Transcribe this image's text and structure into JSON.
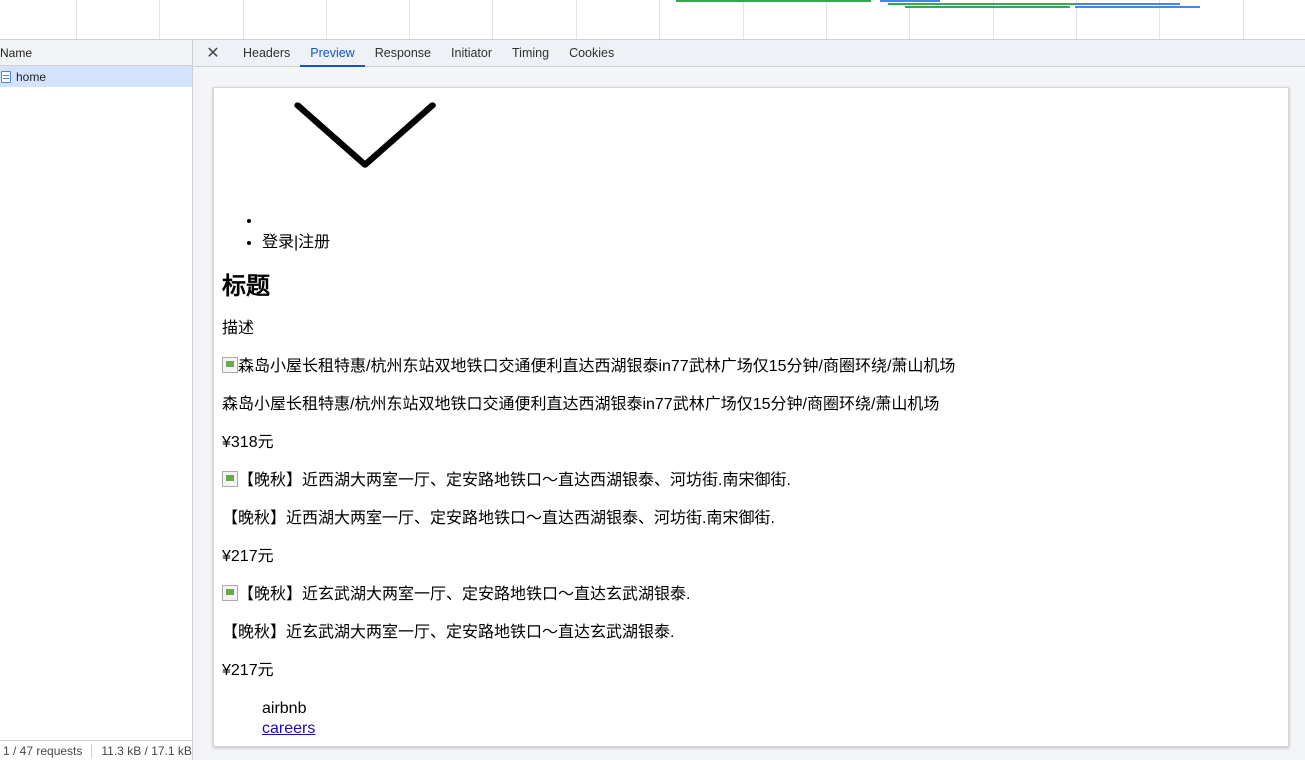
{
  "request_list": {
    "column_header": "Name",
    "rows": [
      {
        "name": "home",
        "icon": "document-icon"
      }
    ],
    "status": {
      "requests": "1 / 47 requests",
      "transferred": "11.3 kB / 17.1 kB"
    }
  },
  "detail_tabs": {
    "close_icon": "close-icon",
    "tabs": [
      "Headers",
      "Preview",
      "Response",
      "Initiator",
      "Timing",
      "Cookies"
    ],
    "active": "Preview"
  },
  "preview": {
    "nav_items": [
      "",
      "登录|注册"
    ],
    "title": "标题",
    "description": "描述",
    "listings": [
      {
        "image_alt": "森岛小屋长租特惠/杭州东站双地铁口交通便利直达西湖银泰in77武林广场仅15分钟/商圈环绕/萧山机场",
        "name": "森岛小屋长租特惠/杭州东站双地铁口交通便利直达西湖银泰in77武林广场仅15分钟/商圈环绕/萧山机场",
        "price": "¥318元"
      },
      {
        "image_alt": "【晚秋】近西湖大两室一厅、定安路地铁口～直达西湖银泰、河坊街.南宋御街.",
        "name": "【晚秋】近西湖大两室一厅、定安路地铁口～直达西湖银泰、河坊街.南宋御街.",
        "price": "¥217元"
      },
      {
        "image_alt": "【晚秋】近玄武湖大两室一厅、定安路地铁口～直达玄武湖银泰.",
        "name": "【晚秋】近玄武湖大两室一厅、定安路地铁口～直达玄武湖银泰.",
        "price": "¥217元"
      }
    ],
    "footer": {
      "brand": "airbnb",
      "link": "careers"
    }
  },
  "colors": {
    "accent": "#0b57d0",
    "selected_row": "#d3e3fd",
    "timeline_green": "#34a853",
    "timeline_blue": "#4285f4"
  }
}
